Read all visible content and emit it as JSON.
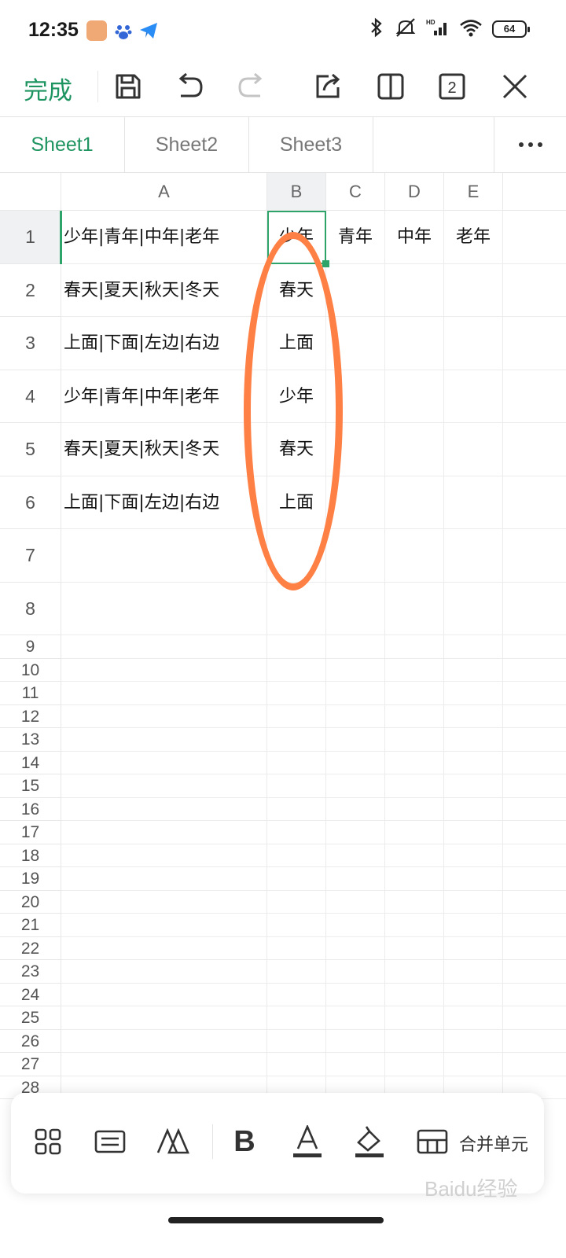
{
  "status_bar": {
    "time": "12:35",
    "battery": "64",
    "icons": [
      "bluetooth-icon",
      "mute-icon",
      "signal-icon",
      "wifi-icon",
      "battery-icon"
    ]
  },
  "toolbar": {
    "done_label": "完成",
    "page_count": "2",
    "icons": [
      "save-icon",
      "undo-icon",
      "redo-icon",
      "share-icon",
      "split-view-icon",
      "page-count-icon",
      "close-icon"
    ]
  },
  "tabs": [
    {
      "label": "Sheet1",
      "active": true
    },
    {
      "label": "Sheet2",
      "active": false
    },
    {
      "label": "Sheet3",
      "active": false
    }
  ],
  "sheet": {
    "columns": [
      "A",
      "B",
      "C",
      "D",
      "E"
    ],
    "rows": [
      "1",
      "2",
      "3",
      "4",
      "5",
      "6",
      "7",
      "8",
      "9",
      "10",
      "11",
      "12",
      "13",
      "14",
      "15",
      "16",
      "17",
      "18",
      "19",
      "20",
      "21",
      "22",
      "23",
      "24",
      "25",
      "26",
      "27",
      "28"
    ],
    "selected_cell": "B1",
    "cells": {
      "A1": "少年|青年|中年|老年",
      "B1": "少年",
      "C1": "青年",
      "D1": "中年",
      "E1": "老年",
      "A2": "春天|夏天|秋天|冬天",
      "B2": "春天",
      "A3": "上面|下面|左边|右边",
      "B3": "上面",
      "A4": "少年|青年|中年|老年",
      "B4": "少年",
      "A5": "春天|夏天|秋天|冬天",
      "B5": "春天",
      "A6": "上面|下面|左边|右边",
      "B6": "上面"
    }
  },
  "bottom_bar": {
    "merge_label": "合并单元",
    "icons": [
      "apps-icon",
      "keyboard-icon",
      "style-icon",
      "bold-icon",
      "font-color-icon",
      "fill-color-icon",
      "merge-cells-icon"
    ]
  },
  "watermark": "Baidu经验"
}
